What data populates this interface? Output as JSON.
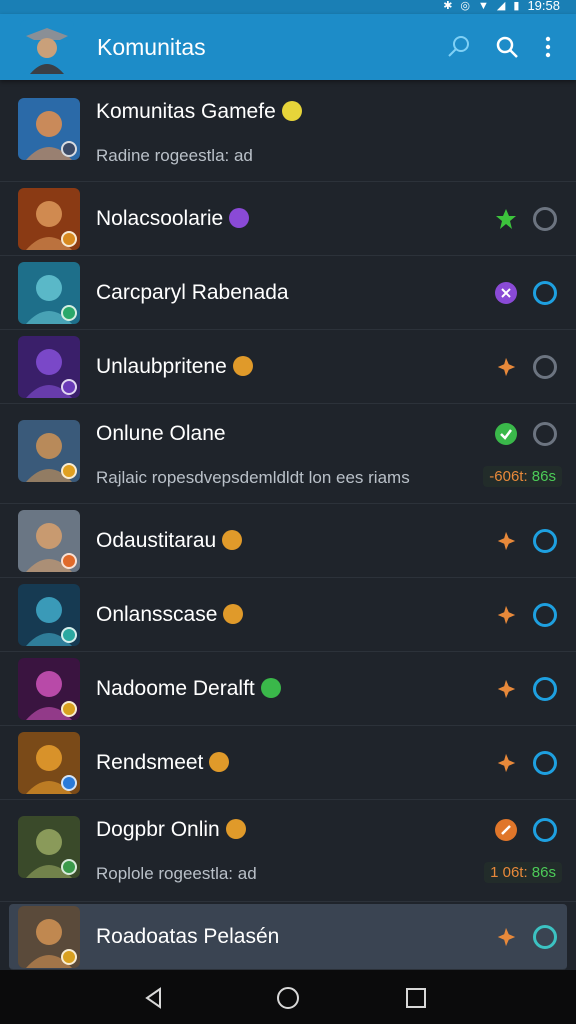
{
  "status_bar": {
    "time": "19:58"
  },
  "app_bar": {
    "title": "Komunitas"
  },
  "list": [
    {
      "name": "Komunitas Gamefe",
      "subtitle": "Radine rogeestla: ad",
      "emoji": "#e6d43a",
      "avatar": "#2b6aa8",
      "avatar_skin": "#c98a5a",
      "badge": "#3a4a66",
      "action": "none",
      "ring": "none"
    },
    {
      "name": "Nolacsoolarie",
      "subtitle": "",
      "emoji": "#8a4ad6",
      "avatar": "#8a3a14",
      "avatar_skin": "#d08a50",
      "badge": "#d88a20",
      "action": "green-star",
      "ring": "gray"
    },
    {
      "name": "Carcparyl Rabenada",
      "subtitle": "",
      "emoji": "",
      "avatar": "#1e6f8a",
      "avatar_skin": "#5ab8c8",
      "badge": "#2aa86a",
      "action": "purple-x",
      "ring": "blue"
    },
    {
      "name": "Unlaubpritene",
      "subtitle": "",
      "emoji": "#e09a2a",
      "avatar": "#3a1f6a",
      "avatar_skin": "#7a48c8",
      "badge": "#6a3ab8",
      "action": "orange-star",
      "ring": "gray"
    },
    {
      "name": "Onlune Olane",
      "subtitle": "Rajlaic ropesdvepsdemldldt lon ees riams",
      "emoji": "",
      "avatar": "#3a5a7a",
      "avatar_skin": "#b88a5a",
      "badge": "#e0a020",
      "action": "green-check",
      "ring": "gray",
      "stat_a": "-606t:",
      "stat_b": "86s"
    },
    {
      "name": "Odaustitarau",
      "subtitle": "",
      "emoji": "#e09a2a",
      "avatar": "#6a7684",
      "avatar_skin": "#c89a70",
      "badge": "#e06a2a",
      "action": "orange-star",
      "ring": "blue"
    },
    {
      "name": "Onlansscase",
      "subtitle": "",
      "emoji": "#e09a2a",
      "avatar": "#163a52",
      "avatar_skin": "#3a9ab8",
      "badge": "#2aa8a0",
      "action": "orange-star",
      "ring": "blue"
    },
    {
      "name": "Nadoome Deralft",
      "subtitle": "",
      "emoji": "#3ab84a",
      "avatar": "#3a1440",
      "avatar_skin": "#b84aa8",
      "badge": "#d8a020",
      "action": "orange-star",
      "ring": "blue"
    },
    {
      "name": "Rendsmeet",
      "subtitle": "",
      "emoji": "#e09a2a",
      "avatar": "#7a4a18",
      "avatar_skin": "#d8922a",
      "badge": "#2a7ad8",
      "action": "orange-star",
      "ring": "blue"
    },
    {
      "name": "Dogpbr Onlin",
      "subtitle": "Roplole rogeestla: ad",
      "emoji": "#e09a2a",
      "avatar": "#3a4a2a",
      "avatar_skin": "#8a9a5a",
      "badge": "#3a9a4a",
      "action": "orange-slash",
      "ring": "blue",
      "stat_a": "1 06t:",
      "stat_b": "86s"
    },
    {
      "name": "Roadoatas Pelasén",
      "subtitle": "",
      "emoji": "",
      "avatar": "#5a4a3a",
      "avatar_skin": "#c08850",
      "badge": "#d8a020",
      "action": "orange-star",
      "ring": "teal"
    }
  ]
}
